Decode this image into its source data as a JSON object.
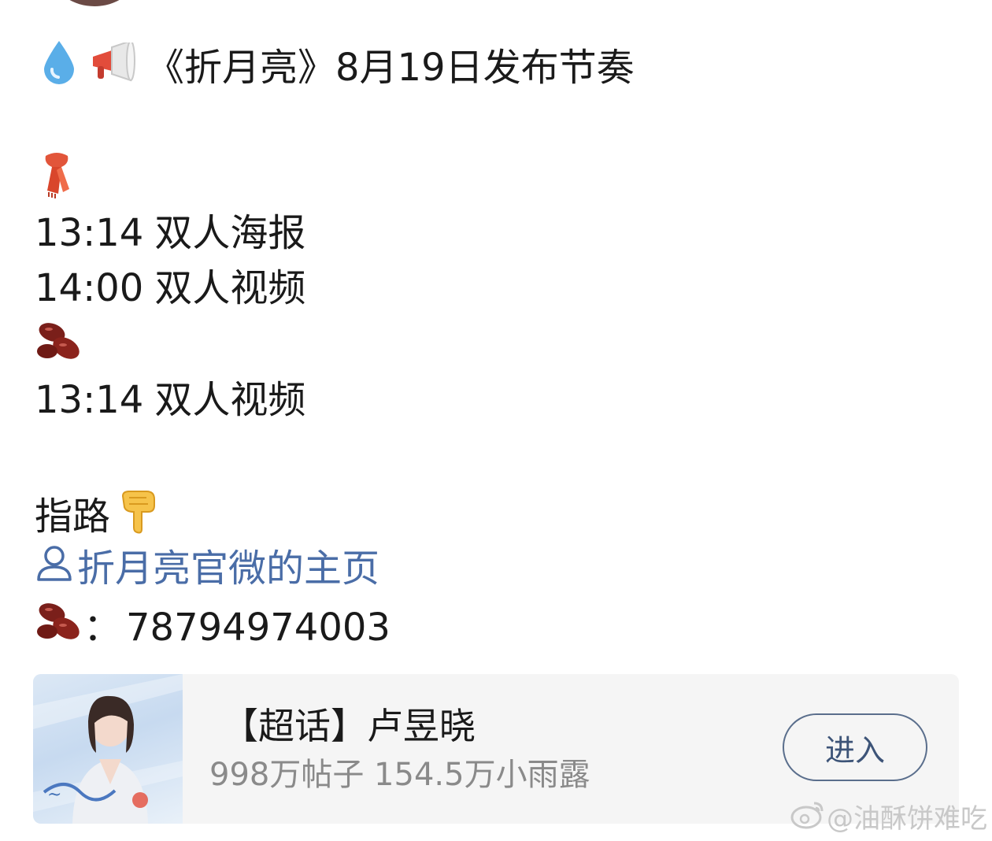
{
  "post": {
    "title": "《折月亮》8月19日发布节奏",
    "schedule_a": [
      {
        "time": "13:14",
        "item": "双人海报"
      },
      {
        "time": "14:00",
        "item": "双人视频"
      }
    ],
    "schedule_b": [
      {
        "time": "13:14",
        "item": "双人视频"
      }
    ],
    "guide_label": "指路",
    "profile_link": "折月亮官微的主页",
    "bean_separator": "：",
    "bean_id": "78794974003"
  },
  "topic_card": {
    "name": "【超话】卢昱晓",
    "stats": "998万帖子 154.5万小雨露",
    "enter_label": "进入"
  },
  "watermark": {
    "text": "@油酥饼难吃"
  },
  "icons": {
    "droplet": "droplet-icon",
    "megaphone": "megaphone-icon",
    "scarf": "scarf-icon",
    "beans": "beans-icon",
    "pointing_down": "pointing-down-icon",
    "user": "user-icon",
    "weibo": "weibo-logo-icon"
  }
}
